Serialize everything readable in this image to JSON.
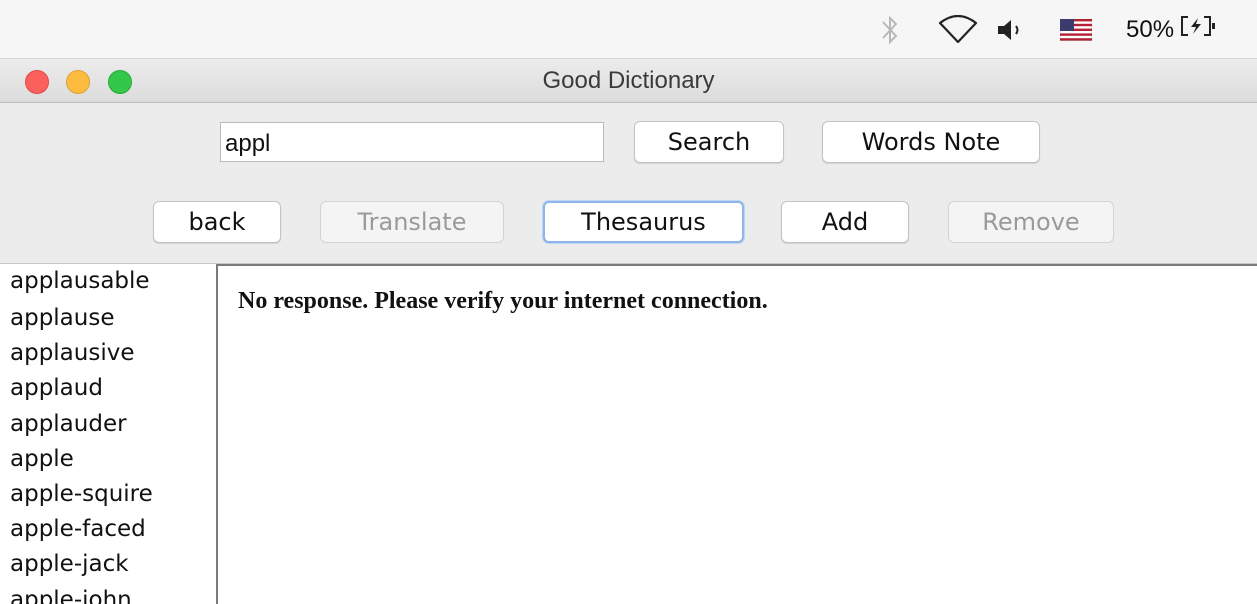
{
  "menubar": {
    "icons": [
      "bluetooth-icon",
      "wifi-icon",
      "volume-icon",
      "us-flag-icon"
    ],
    "battery_text": "50%"
  },
  "window": {
    "title": "Good Dictionary"
  },
  "toolbar": {
    "search_value": "appl",
    "search_label": "Search",
    "words_note_label": "Words Note",
    "back_label": "back",
    "translate_label": "Translate",
    "thesaurus_label": "Thesaurus",
    "add_label": "Add",
    "remove_label": "Remove"
  },
  "wordlist": {
    "items": [
      "applausable",
      "applause",
      "applausive",
      "applaud",
      "applauder",
      "apple",
      "apple-squire",
      "apple-faced",
      "apple-jack",
      "apple-john"
    ]
  },
  "result": {
    "message": "No response. Please verify your internet connection."
  },
  "colors": {
    "close": "#fc605c",
    "minimize": "#fdbc40",
    "maximize": "#34c84a",
    "focus_ring": "#8fb5e9"
  }
}
